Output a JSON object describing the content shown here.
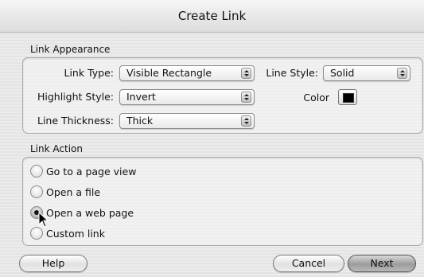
{
  "window": {
    "title": "Create Link"
  },
  "appearance": {
    "group_title": "Link Appearance",
    "link_type_label": "Link Type:",
    "link_type_value": "Visible Rectangle",
    "line_style_label": "Line Style:",
    "line_style_value": "Solid",
    "highlight_style_label": "Highlight Style:",
    "highlight_style_value": "Invert",
    "color_label": "Color",
    "color_value": "#000000",
    "line_thickness_label": "Line Thickness:",
    "line_thickness_value": "Thick"
  },
  "action": {
    "group_title": "Link Action",
    "options": [
      {
        "label": "Go to a page view",
        "checked": false
      },
      {
        "label": "Open a file",
        "checked": false
      },
      {
        "label": "Open a web page",
        "checked": true
      },
      {
        "label": "Custom link",
        "checked": false
      }
    ]
  },
  "buttons": {
    "help": "Help",
    "cancel": "Cancel",
    "next": "Next"
  }
}
